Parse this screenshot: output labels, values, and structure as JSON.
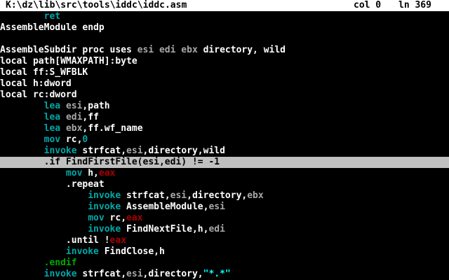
{
  "status": {
    "file_path": "K:\\dz\\lib\\src\\tools\\iddc\\iddc.asm",
    "col": "col 0",
    "line": "ln 369"
  },
  "colors": {
    "text": "#ffffff",
    "background": "#000000",
    "keyword": "#ffffff",
    "instruction": "#00a8a8",
    "register": "#a8a8a8",
    "number": "#00a8a8",
    "string": "#00ffff",
    "eax": "#a80000",
    "directive": "#00a800",
    "cursor_line_bg": "#c0c0c0",
    "cursor_line_fg": "#000000"
  },
  "code_lines": [
    {
      "current": false,
      "tokens": [
        {
          "t": "        "
        },
        {
          "t": "ret",
          "c": "instruction"
        }
      ]
    },
    {
      "current": false,
      "tokens": [
        {
          "t": "AssembleModule endp"
        }
      ]
    },
    {
      "current": false,
      "tokens": [
        {
          "t": ""
        }
      ]
    },
    {
      "current": false,
      "tokens": [
        {
          "t": "AssembleSubdir proc uses "
        },
        {
          "t": "esi",
          "c": "register"
        },
        {
          "t": " "
        },
        {
          "t": "edi",
          "c": "register"
        },
        {
          "t": " "
        },
        {
          "t": "ebx",
          "c": "register"
        },
        {
          "t": " directory, wild"
        }
      ]
    },
    {
      "current": false,
      "tokens": [
        {
          "t": "local path[WMAXPATH]:byte"
        }
      ]
    },
    {
      "current": false,
      "tokens": [
        {
          "t": "local ff:S_WFBLK"
        }
      ]
    },
    {
      "current": false,
      "tokens": [
        {
          "t": "local h:dword"
        }
      ]
    },
    {
      "current": false,
      "tokens": [
        {
          "t": "local rc:dword"
        }
      ]
    },
    {
      "current": false,
      "tokens": [
        {
          "t": "        "
        },
        {
          "t": "lea",
          "c": "instruction"
        },
        {
          "t": " "
        },
        {
          "t": "esi",
          "c": "register"
        },
        {
          "t": ",path"
        }
      ]
    },
    {
      "current": false,
      "tokens": [
        {
          "t": "        "
        },
        {
          "t": "lea",
          "c": "instruction"
        },
        {
          "t": " "
        },
        {
          "t": "edi",
          "c": "register"
        },
        {
          "t": ",ff"
        }
      ]
    },
    {
      "current": false,
      "tokens": [
        {
          "t": "        "
        },
        {
          "t": "lea",
          "c": "instruction"
        },
        {
          "t": " "
        },
        {
          "t": "ebx",
          "c": "register"
        },
        {
          "t": ",ff.wf_name"
        }
      ]
    },
    {
      "current": false,
      "tokens": [
        {
          "t": "        "
        },
        {
          "t": "mov",
          "c": "instruction"
        },
        {
          "t": " rc,"
        },
        {
          "t": "0",
          "c": "number"
        }
      ]
    },
    {
      "current": false,
      "tokens": [
        {
          "t": "        "
        },
        {
          "t": "invoke",
          "c": "instruction"
        },
        {
          "t": " strfcat,"
        },
        {
          "t": "esi",
          "c": "register"
        },
        {
          "t": ",directory,wild"
        }
      ]
    },
    {
      "current": true,
      "tokens": [
        {
          "t": "        .if FindFirstFile(esi,edi) != -1"
        }
      ]
    },
    {
      "current": false,
      "tokens": [
        {
          "t": "            "
        },
        {
          "t": "mov",
          "c": "instruction"
        },
        {
          "t": " h,"
        },
        {
          "t": "eax",
          "c": "eax"
        }
      ]
    },
    {
      "current": false,
      "tokens": [
        {
          "t": "            .repeat"
        }
      ]
    },
    {
      "current": false,
      "tokens": [
        {
          "t": "                "
        },
        {
          "t": "invoke",
          "c": "instruction"
        },
        {
          "t": " strfcat,"
        },
        {
          "t": "esi",
          "c": "register"
        },
        {
          "t": ",directory,"
        },
        {
          "t": "ebx",
          "c": "register"
        }
      ]
    },
    {
      "current": false,
      "tokens": [
        {
          "t": "                "
        },
        {
          "t": "invoke",
          "c": "instruction"
        },
        {
          "t": " AssembleModule,"
        },
        {
          "t": "esi",
          "c": "register"
        }
      ]
    },
    {
      "current": false,
      "tokens": [
        {
          "t": "                "
        },
        {
          "t": "mov",
          "c": "instruction"
        },
        {
          "t": " rc,"
        },
        {
          "t": "eax",
          "c": "eax"
        }
      ]
    },
    {
      "current": false,
      "tokens": [
        {
          "t": "                "
        },
        {
          "t": "invoke",
          "c": "instruction"
        },
        {
          "t": " FindNextFile,h,"
        },
        {
          "t": "edi",
          "c": "register"
        }
      ]
    },
    {
      "current": false,
      "tokens": [
        {
          "t": "            .until !"
        },
        {
          "t": "eax",
          "c": "eax"
        }
      ]
    },
    {
      "current": false,
      "tokens": [
        {
          "t": "            "
        },
        {
          "t": "invoke",
          "c": "instruction"
        },
        {
          "t": " FindClose,h"
        }
      ]
    },
    {
      "current": false,
      "tokens": [
        {
          "t": "        "
        },
        {
          "t": ".endif",
          "c": "directive"
        }
      ]
    },
    {
      "current": false,
      "tokens": [
        {
          "t": "        "
        },
        {
          "t": "invoke",
          "c": "instruction"
        },
        {
          "t": " strfcat,"
        },
        {
          "t": "esi",
          "c": "register"
        },
        {
          "t": ",directory,"
        },
        {
          "t": "\"*.*\"",
          "c": "string"
        }
      ]
    }
  ]
}
